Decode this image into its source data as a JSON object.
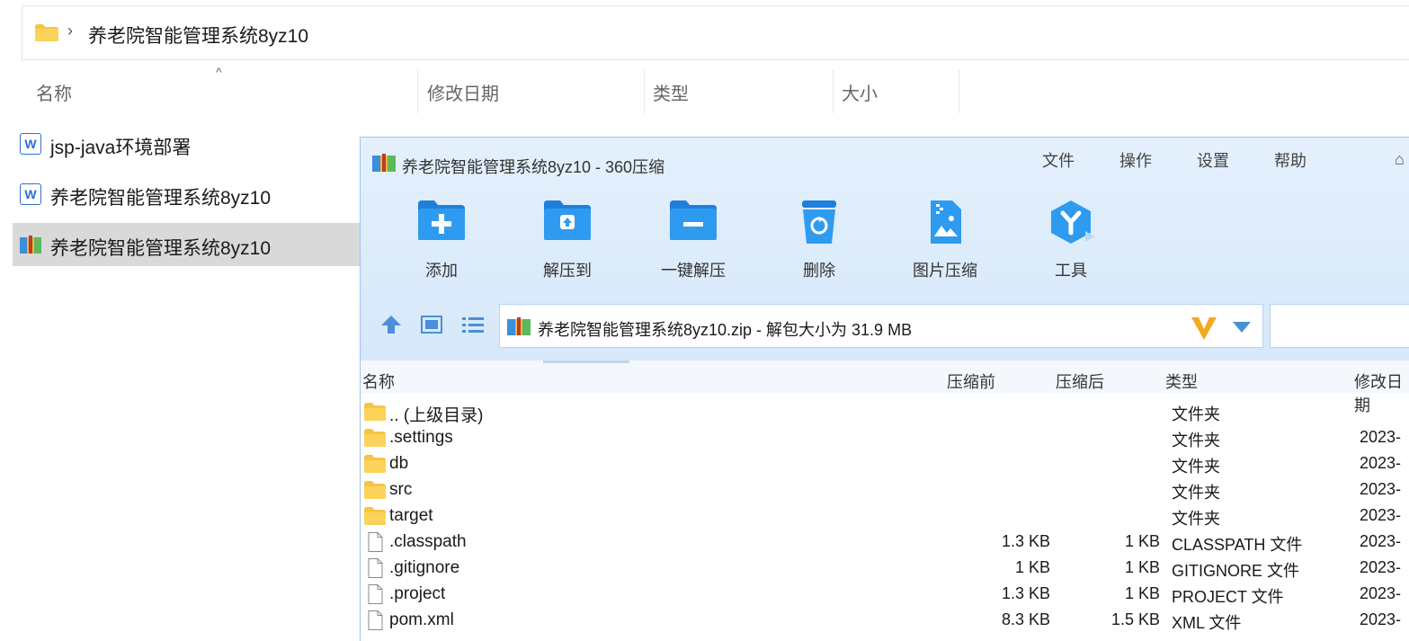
{
  "explorer": {
    "breadcrumb": "养老院智能管理系统8yz10",
    "columns": [
      "名称",
      "修改日期",
      "类型",
      "大小"
    ],
    "files": [
      {
        "name": "jsp-java环境部署",
        "icon": "wps-doc-icon"
      },
      {
        "name": "养老院智能管理系统8yz10",
        "icon": "wps-doc-icon"
      },
      {
        "name": "养老院智能管理系统8yz10",
        "icon": "zip-archive-icon"
      }
    ]
  },
  "archiver": {
    "title": "养老院智能管理系统8yz10 - 360压缩",
    "menu": [
      "文件",
      "操作",
      "设置",
      "帮助"
    ],
    "tools": [
      "添加",
      "解压到",
      "一键解压",
      "删除",
      "图片压缩",
      "工具"
    ],
    "path": "养老院智能管理系统8yz10.zip - 解包大小为 31.9 MB",
    "columns": [
      "名称",
      "压缩前",
      "压缩后",
      "类型",
      "修改日期"
    ],
    "rows": [
      {
        "name": ".. (上级目录)",
        "before": "",
        "after": "",
        "type": "文件夹",
        "date": "",
        "icon": "folder-icon"
      },
      {
        "name": ".settings",
        "before": "",
        "after": "",
        "type": "文件夹",
        "date": "2023-",
        "icon": "folder-icon"
      },
      {
        "name": "db",
        "before": "",
        "after": "",
        "type": "文件夹",
        "date": "2023-",
        "icon": "folder-icon"
      },
      {
        "name": "src",
        "before": "",
        "after": "",
        "type": "文件夹",
        "date": "2023-",
        "icon": "folder-icon"
      },
      {
        "name": "target",
        "before": "",
        "after": "",
        "type": "文件夹",
        "date": "2023-",
        "icon": "folder-icon"
      },
      {
        "name": ".classpath",
        "before": "1.3 KB",
        "after": "1 KB",
        "type": "CLASSPATH 文件",
        "date": "2023-",
        "icon": "file-icon"
      },
      {
        "name": ".gitignore",
        "before": "1 KB",
        "after": "1 KB",
        "type": "GITIGNORE 文件",
        "date": "2023-",
        "icon": "file-icon"
      },
      {
        "name": ".project",
        "before": "1.3 KB",
        "after": "1 KB",
        "type": "PROJECT 文件",
        "date": "2023-",
        "icon": "file-icon"
      },
      {
        "name": "pom.xml",
        "before": "8.3 KB",
        "after": "1.5 KB",
        "type": "XML 文件",
        "date": "2023-",
        "icon": "file-icon"
      }
    ]
  },
  "colors": {
    "accent": "#2f8ee8",
    "selection": "#d9d9d9",
    "titlebar": "#dceafa"
  }
}
